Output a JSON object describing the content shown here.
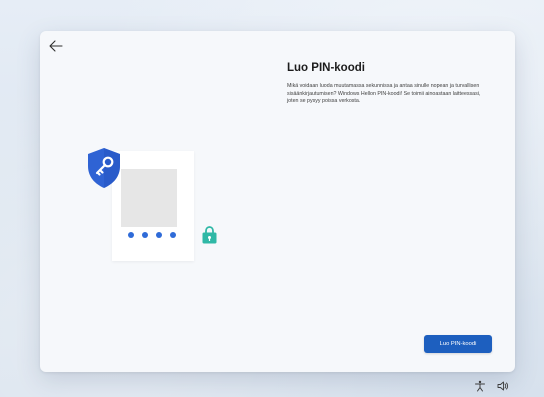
{
  "window": {
    "back_icon": "back-arrow-icon"
  },
  "page": {
    "title": "Luo PIN-koodi",
    "description": "Mikä voidaan luoda muutamassa sekunnissa ja antaa sinulle nopean ja turvallisen sisäänkirjautumisen? Windows Hellon PIN-koodi! Se toimii ainoastaan laitteessasi, joten se pysyy poissa verkosta."
  },
  "illustration": {
    "shield_icon": "shield-key-icon",
    "lock_icon": "padlock-icon",
    "pin_dot_count": 4,
    "colors": {
      "shield": "#2f63d4",
      "pin_dots": "#2f6bd8",
      "lock": "#2fb8a6"
    }
  },
  "actions": {
    "create_pin_label": "Luo PIN-koodi",
    "button_color": "#1d5fbf"
  },
  "system_tray": {
    "icons": [
      "accessibility-icon",
      "volume-icon"
    ]
  }
}
